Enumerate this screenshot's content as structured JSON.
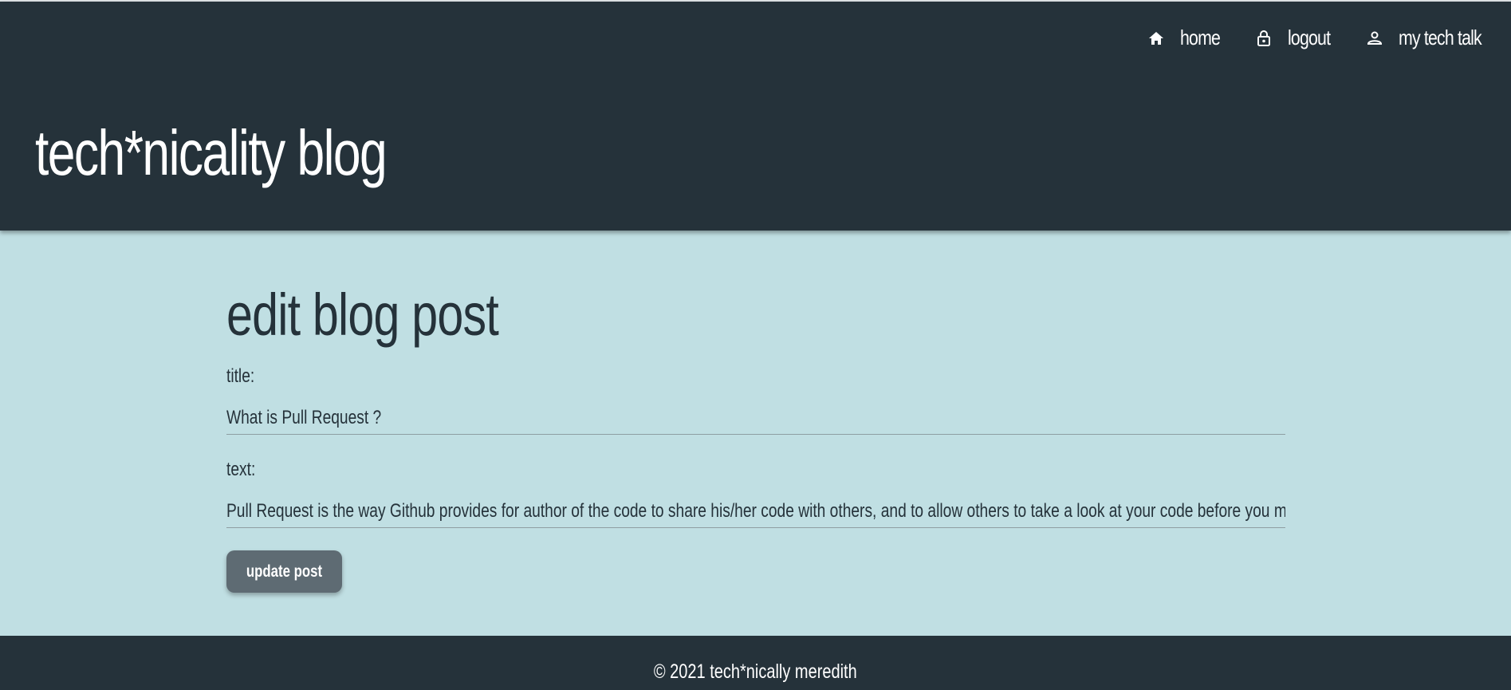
{
  "nav": {
    "items": [
      {
        "label": "home",
        "icon": "home-icon"
      },
      {
        "label": "logout",
        "icon": "lock-icon"
      },
      {
        "label": "my tech talk",
        "icon": "user-icon"
      }
    ]
  },
  "header": {
    "site_title": "tech*nicality blog"
  },
  "main": {
    "page_title": "edit blog post",
    "title_label": "title:",
    "title_value": "What is Pull Request ?",
    "text_label": "text:",
    "text_value": "Pull Request is the way Github provides for author of the code to share his/her code with others, and to allow others to take a look at your code before you merge it into the main branch.",
    "update_button": "update post"
  },
  "footer": {
    "copyright": "© 2021 tech*nically meredith"
  },
  "colors": {
    "header_bg": "#25323a",
    "page_bg": "#c0dfe3",
    "button_bg": "#5e6b73",
    "text_dark": "#25323a"
  }
}
